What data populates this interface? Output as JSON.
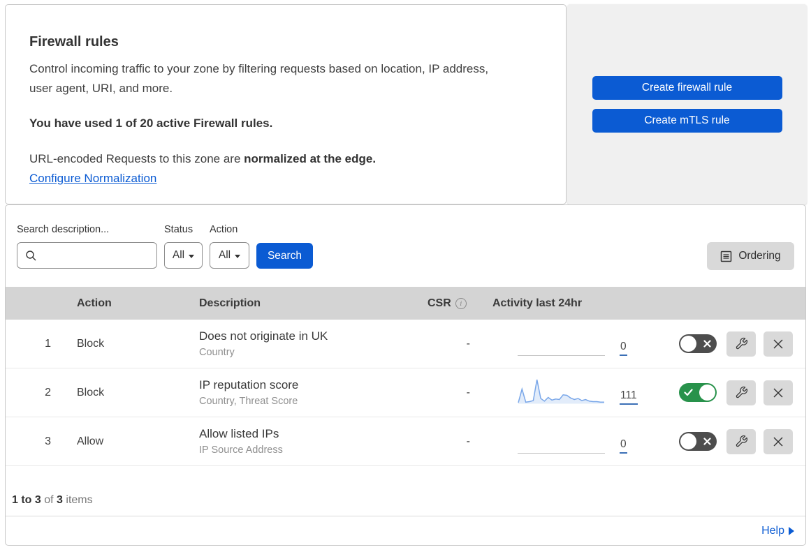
{
  "colors": {
    "accent_blue": "#0b5bd3",
    "toggle_on_green": "#28924b",
    "toggle_off_gray": "#4d4d4d",
    "panel_gray": "#f0f0f0",
    "table_header_gray": "#d4d4d4",
    "button_gray": "#d9d9d9",
    "sparkline_blue": "#7aa7e9"
  },
  "intro": {
    "title": "Firewall rules",
    "description": "Control incoming traffic to your zone by filtering requests based on location, IP address, user agent, URI, and more.",
    "usage_bold": "You have used 1 of 20 active Firewall rules.",
    "normalization_prefix": "URL-encoded Requests to this zone are ",
    "normalization_bold": "normalized at the edge.",
    "normalization_link": "Configure Normalization"
  },
  "cta": {
    "create_firewall_label": "Create firewall rule",
    "create_mtls_label": "Create mTLS rule"
  },
  "filters": {
    "search_label": "Search description...",
    "status_label": "Status",
    "status_value": "All",
    "action_label": "Action",
    "action_value": "All",
    "search_button": "Search",
    "ordering_button": "Ordering"
  },
  "table": {
    "headers": {
      "action": "Action",
      "description": "Description",
      "csr": "CSR",
      "activity": "Activity last 24hr"
    },
    "rows": [
      {
        "num": "1",
        "action": "Block",
        "title": "Does not originate in UK",
        "subtitle": "Country",
        "csr": "-",
        "count": "0",
        "enabled": false
      },
      {
        "num": "2",
        "action": "Block",
        "title": "IP reputation score",
        "subtitle": "Country, Threat Score",
        "csr": "-",
        "count": "111",
        "enabled": true
      },
      {
        "num": "3",
        "action": "Allow",
        "title": "Allow listed IPs",
        "subtitle": "IP Source Address",
        "csr": "-",
        "count": "0",
        "enabled": false
      }
    ]
  },
  "chart_data": {
    "type": "area",
    "title": "Activity last 24hr sparkline for rule 2",
    "total_label": "111",
    "values": [
      2,
      28,
      3,
      4,
      6,
      46,
      10,
      5,
      12,
      7,
      9,
      8,
      17,
      16,
      11,
      8,
      10,
      6,
      8,
      5,
      4,
      4,
      3,
      3
    ]
  },
  "footer": {
    "range_bold": "1 to 3",
    "of_text": "of",
    "total_bold": "3",
    "items_text": "items",
    "help_label": "Help"
  }
}
